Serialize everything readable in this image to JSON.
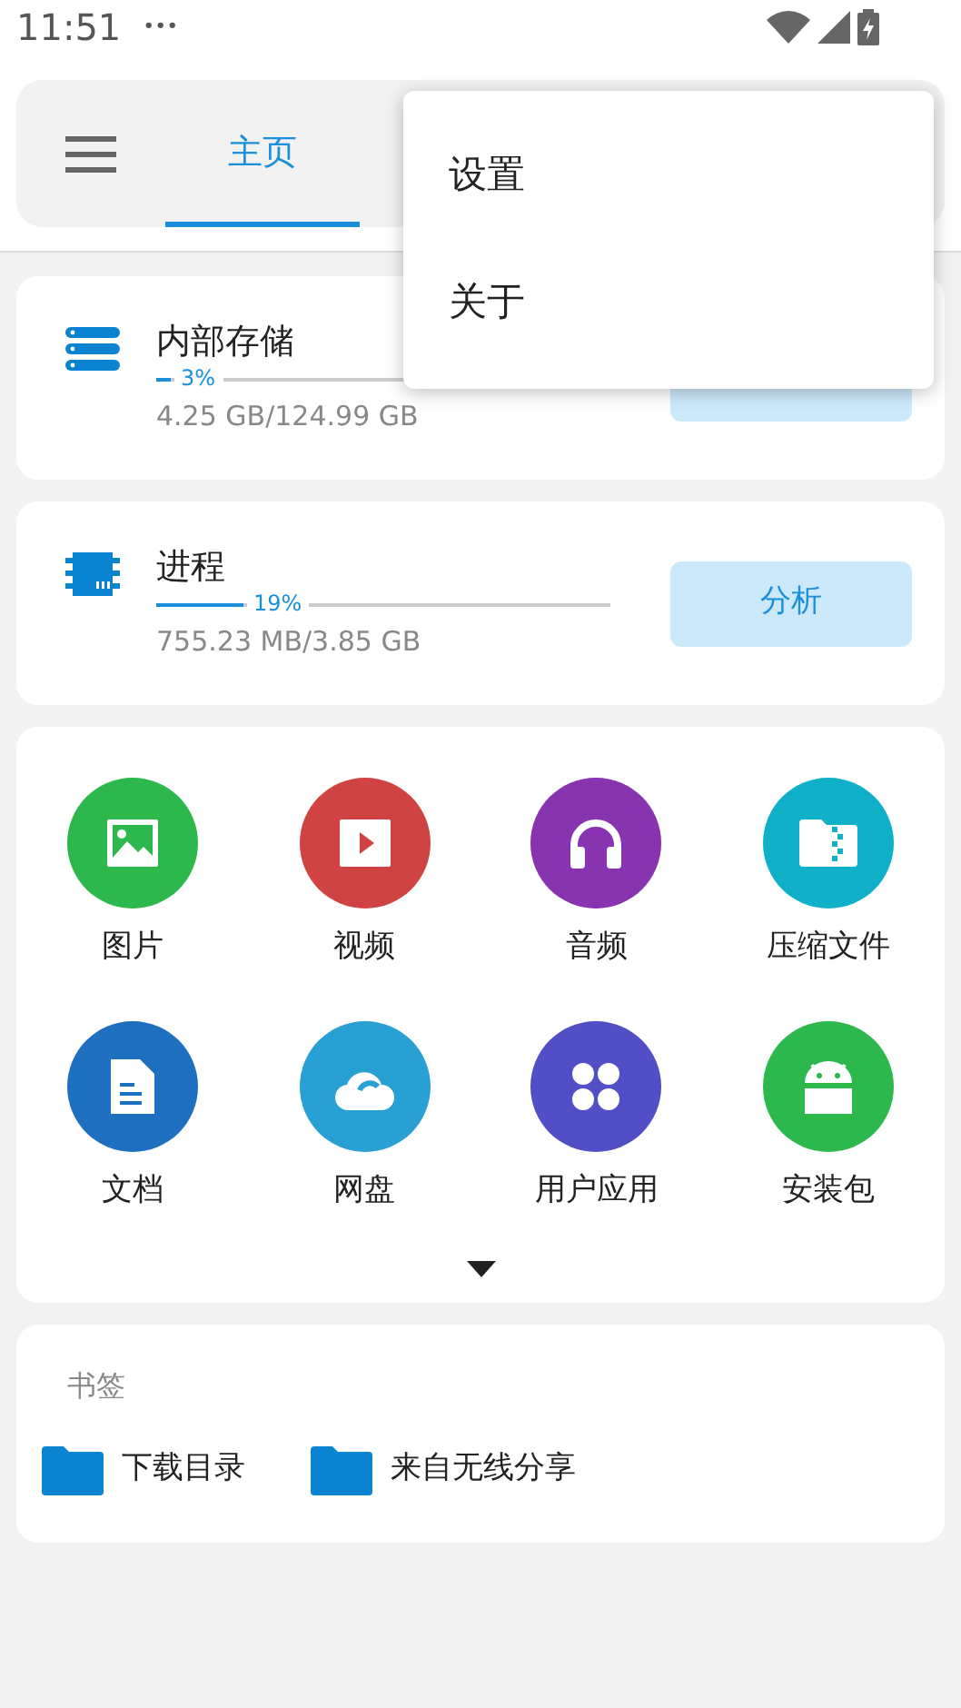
{
  "status_bar": {
    "time": "11:51",
    "more": "•••"
  },
  "top_bar": {
    "tabs": [
      {
        "label": "主页",
        "selected": true
      }
    ]
  },
  "menu": {
    "items": [
      {
        "label": "设置"
      },
      {
        "label": "关于"
      }
    ]
  },
  "cards": [
    {
      "kind": "storage",
      "title": "内部存储",
      "level": 0.03,
      "percent": "3%",
      "usage": "4.25 GB/124.99 GB",
      "action": {
        "kind": "button"
      }
    },
    {
      "kind": "chip",
      "title": "进程",
      "level": 0.19,
      "percent": "19%",
      "usage": "755.23 MB/3.85 GB",
      "action": {
        "label": "分析"
      }
    }
  ],
  "categories": [
    {
      "kind": "image",
      "label": "图片",
      "color": "#2db84d"
    },
    {
      "kind": "video",
      "label": "视频",
      "color": "#d04343"
    },
    {
      "kind": "audio",
      "label": "音频",
      "color": "#8833b0"
    },
    {
      "kind": "archive",
      "label": "压缩文件",
      "color": "#10b0c8"
    },
    {
      "kind": "document",
      "label": "文档",
      "color": "#1e6fc0"
    },
    {
      "kind": "cloud",
      "label": "网盘",
      "color": "#29a0d4"
    },
    {
      "kind": "apps",
      "label": "用户应用",
      "color": "#524fc6"
    },
    {
      "kind": "android",
      "label": "安装包",
      "color": "#2db84d"
    }
  ],
  "bookmarks": {
    "title": "书签",
    "items": [
      {
        "label": "下载目录"
      },
      {
        "label": "来自无线分享"
      }
    ]
  }
}
